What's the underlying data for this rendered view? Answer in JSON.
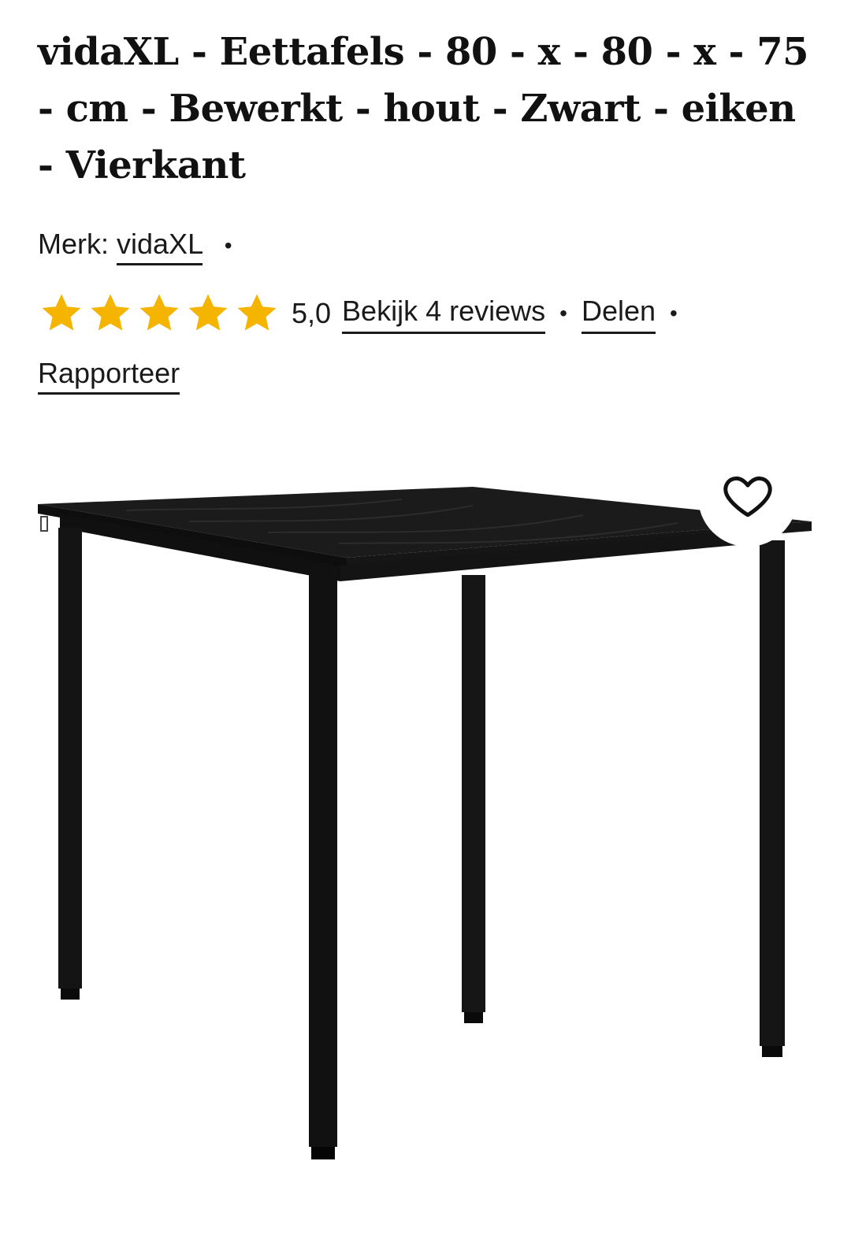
{
  "product": {
    "title": "vidaXL - Eettafels - 80 - x - 80 - x - 75 - cm - Bewerkt - hout - Zwart - eiken - Vierkant",
    "brand_label": "Merk:",
    "brand_name": "vidaXL",
    "rating": "5,0",
    "rating_stars": 5,
    "reviews_link": "Bekijk 4 reviews",
    "share_link": "Delen",
    "report_link": "Rapporteer",
    "separator": "•"
  },
  "icons": {
    "star": "star-icon",
    "favorite": "heart-outline-icon"
  },
  "colors": {
    "star": "#f5b400",
    "text": "#111111",
    "table": "#1c1c1c"
  }
}
